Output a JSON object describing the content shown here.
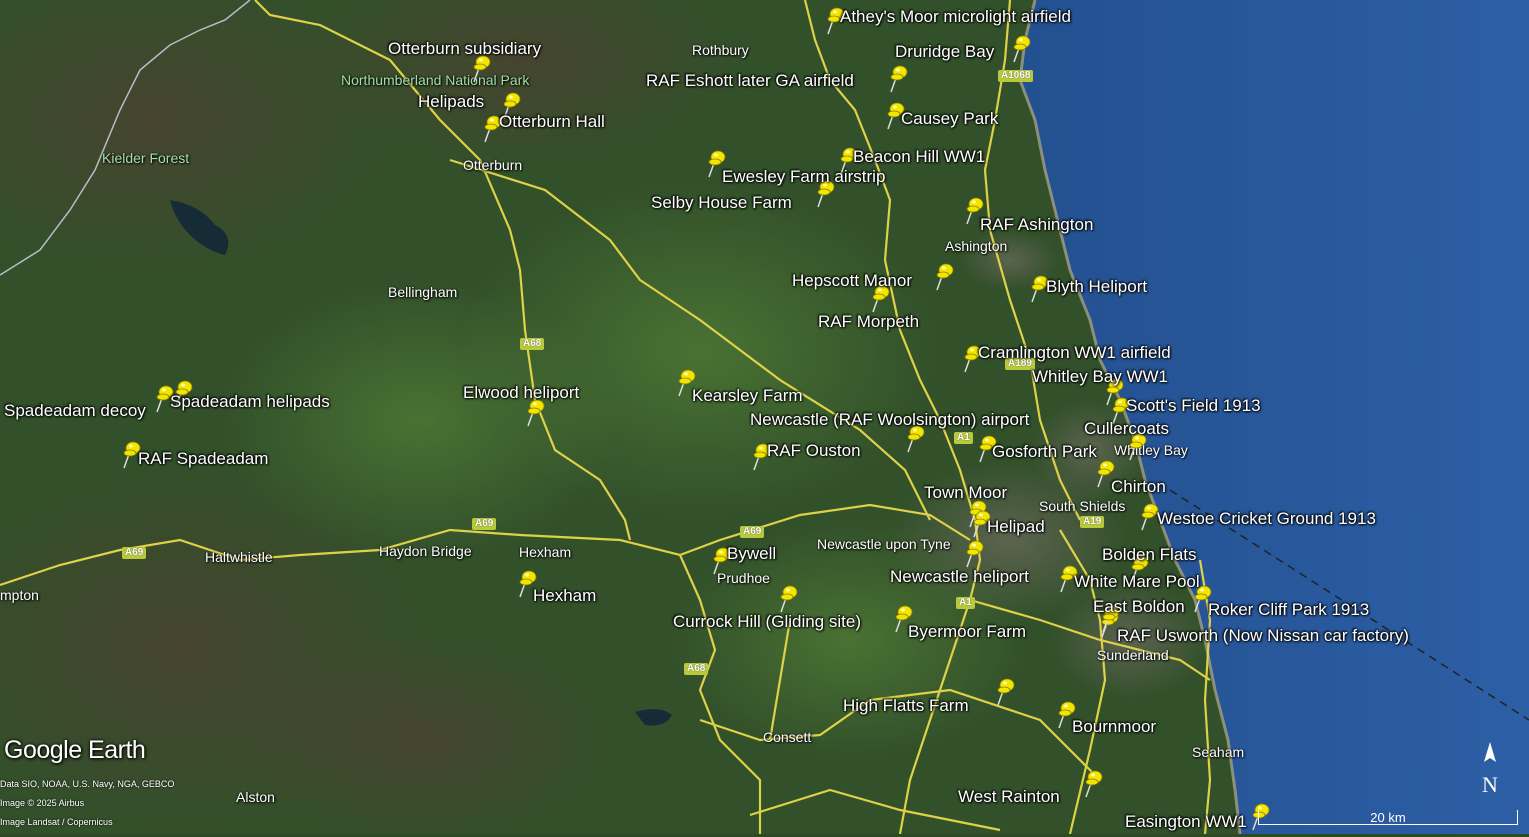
{
  "map": {
    "provider_logo": "Google Earth",
    "credits": [
      "Data SIO, NOAA, U.S. Navy, NGA, GEBCO",
      "Image © 2025 Airbus",
      "Image Landsat / Copernicus"
    ],
    "scale_label": "20 km",
    "compass_label": "N",
    "colors": {
      "sea": "#2f5a9e",
      "land": "#33512a",
      "road": "#e8d84a",
      "pin": "#f2e600"
    }
  },
  "airfields": [
    "Athey's Moor microlight airfield",
    "Druridge Bay",
    "RAF Eshott later GA airfield",
    "Causey Park",
    "Otterburn subsidiary",
    "Helipads",
    "Otterburn Hall",
    "Beacon Hill WW1",
    "Ewesley Farm airstrip",
    "Selby House Farm",
    "RAF Ashington",
    "Hepscott Manor",
    "Blyth Heliport",
    "RAF Morpeth",
    "Cramlington WW1 airfield",
    "Whitley Bay WW1",
    "Scott's Field 1913",
    "Newcastle (RAF Woolsington) airport",
    "Cullercoats",
    "Elwood heliport",
    "Kearsley Farm",
    "Spadeadam decoy",
    "Spadeadam helipads",
    "RAF Spadeadam",
    "RAF Ouston",
    "Gosforth Park",
    "Town Moor",
    "Chirton",
    "Helipad",
    "Westoe Cricket Ground 1913",
    "Bywell",
    "Hexham",
    "Bolden Flats",
    "Newcastle heliport",
    "White Mare Pool",
    "East Boldon",
    "Roker Cliff Park 1913",
    "Currock Hill (Gliding site)",
    "Byermoor Farm",
    "RAF Usworth  (Now Nissan car factory)",
    "High Flatts Farm",
    "Bournmoor",
    "West Rainton",
    "Easington WW1"
  ],
  "places": [
    "Rothbury",
    "Northumberland National Park",
    "Kielder Forest",
    "Otterburn",
    "Ashington",
    "Bellingham",
    "Whitley Bay",
    "South Shields",
    "Newcastle upon Tyne",
    "Haltwhistle",
    "Haydon Bridge",
    "Hexham",
    "Prudhoe",
    "Sunderland",
    "Consett",
    "Seaham",
    "Alston",
    "mpton"
  ],
  "roads": [
    "A1068",
    "A68",
    "A189",
    "A1",
    "A19",
    "A69",
    "A69",
    "A69",
    "A1",
    "A68"
  ]
}
